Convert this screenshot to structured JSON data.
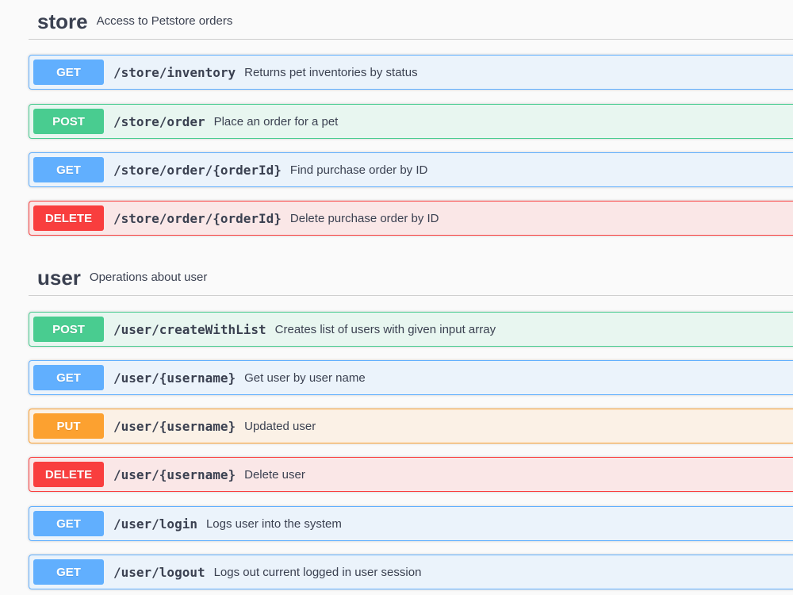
{
  "sections": [
    {
      "name": "store",
      "description": "Access to Petstore orders",
      "operations": [
        {
          "method": "GET",
          "path": "/store/inventory",
          "summary": "Returns pet inventories by status"
        },
        {
          "method": "POST",
          "path": "/store/order",
          "summary": "Place an order for a pet"
        },
        {
          "method": "GET",
          "path": "/store/order/{orderId}",
          "summary": "Find purchase order by ID"
        },
        {
          "method": "DELETE",
          "path": "/store/order/{orderId}",
          "summary": "Delete purchase order by ID"
        }
      ]
    },
    {
      "name": "user",
      "description": "Operations about user",
      "operations": [
        {
          "method": "POST",
          "path": "/user/createWithList",
          "summary": "Creates list of users with given input array"
        },
        {
          "method": "GET",
          "path": "/user/{username}",
          "summary": "Get user by user name"
        },
        {
          "method": "PUT",
          "path": "/user/{username}",
          "summary": "Updated user"
        },
        {
          "method": "DELETE",
          "path": "/user/{username}",
          "summary": "Delete user"
        },
        {
          "method": "GET",
          "path": "/user/login",
          "summary": "Logs user into the system"
        },
        {
          "method": "GET",
          "path": "/user/logout",
          "summary": "Logs out current logged in user session"
        }
      ]
    }
  ],
  "colors": {
    "get": "#61affe",
    "post": "#49cc90",
    "put": "#fca130",
    "delete": "#f93e3e",
    "text": "#3b4151"
  }
}
